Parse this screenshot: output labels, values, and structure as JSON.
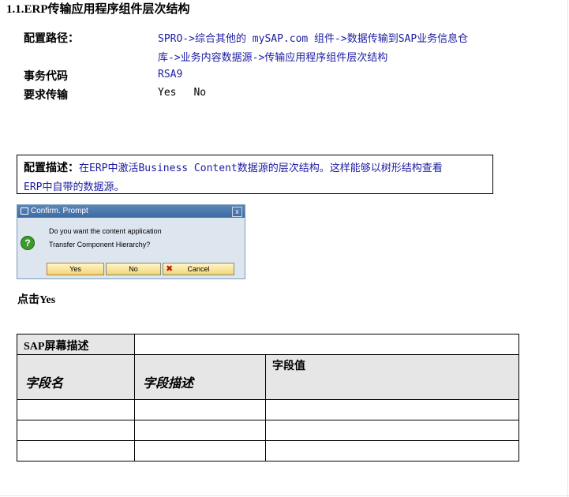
{
  "title": "1.1.ERP传输应用程序组件层次结构",
  "config_path": {
    "label": "配置路径：",
    "line1": "SPRO->综合其他的 mySAP.com 组件->数据传输到SAP业务信息仓",
    "line2": "库->业务内容数据源->传输应用程序组件层次结构"
  },
  "transaction": {
    "label": "事务代码",
    "value": "RSA9"
  },
  "transport": {
    "label": "要求传输",
    "yes": "Yes",
    "no": "No"
  },
  "description": {
    "label": "配置描述：",
    "line1": "在ERP中激活Business Content数据源的层次结构。这样能够以树形结构查看",
    "line2": "ERP中自带的数据源。"
  },
  "dialog": {
    "title": "Confirm. Prompt",
    "close": "x",
    "message_line1": "Do you want the content application",
    "message_line2": "Transfer Component Hierarchy?",
    "yes_label": "Yes",
    "no_label": "No",
    "cancel_label": "Cancel",
    "icons": {
      "title": "window-icon",
      "question": "question-icon",
      "cancel": "cancel-x-icon"
    }
  },
  "instruction": "点击Yes",
  "table": {
    "screen_desc_header": "SAP屏幕描述",
    "columns": [
      "字段名",
      "字段描述",
      "字段值"
    ],
    "rows": [
      [
        "",
        "",
        ""
      ],
      [
        "",
        "",
        ""
      ],
      [
        "",
        "",
        ""
      ]
    ]
  }
}
